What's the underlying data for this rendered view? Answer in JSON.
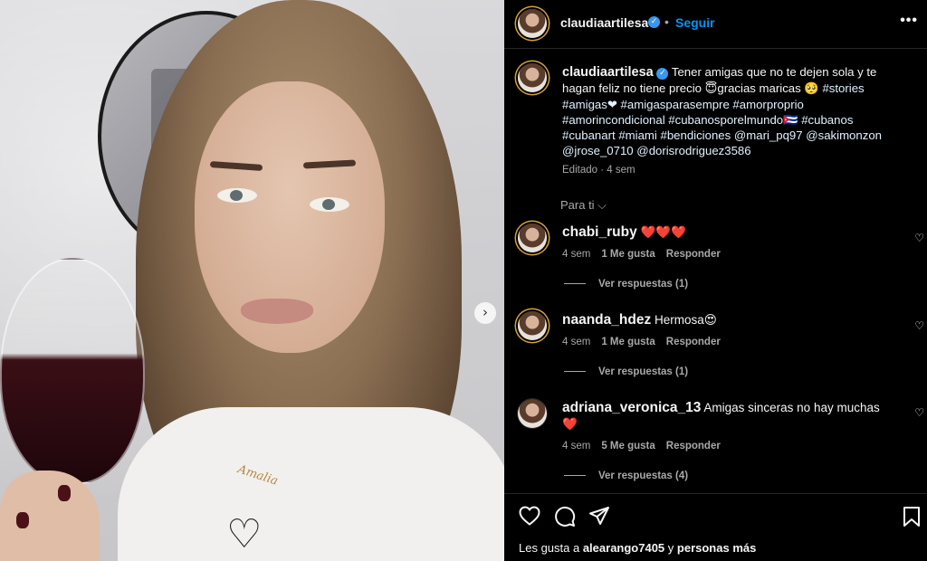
{
  "post": {
    "username": "claudiaartilesa",
    "follow_label": "Seguir",
    "more_label": "•••",
    "dot": "•"
  },
  "caption": {
    "username": "claudiaartilesa",
    "text_part1": "Tener amigas que no te dejen sola y te hagan feliz no tiene precio 😇gracias maricas 🥺 ",
    "hashtags": "#stories #amigas❤ #amigasparasempre #amorproprio #amorincondicional #cubanosporelmundo🇨🇺 #cubanos #cubanart #miami #bendiciones",
    "mentions": "@mari_pq97 @sakimonzon @jrose_0710 @dorisrodriguez3586",
    "meta": "Editado · 4 sem"
  },
  "filter": {
    "label": "Para ti ⌵"
  },
  "comments": [
    {
      "username": "chabi_ruby",
      "text": "❤️❤️❤️",
      "time": "4 sem",
      "likes": "1 Me gusta",
      "reply": "Responder",
      "view_replies": "Ver respuestas (1)"
    },
    {
      "username": "naanda_hdez",
      "text": "Hermosa😍",
      "time": "4 sem",
      "likes": "1 Me gusta",
      "reply": "Responder",
      "view_replies": "Ver respuestas (1)"
    },
    {
      "username": "adriana_veronica_13",
      "text": "Amigas sinceras no hay muchas",
      "text2": "❤️",
      "time": "4 sem",
      "likes": "5 Me gusta",
      "reply": "Responder",
      "view_replies": "Ver respuestas (4)"
    }
  ],
  "likes_line": {
    "prefix": "Les gusta a ",
    "user": "alearango7405",
    "middle": " y ",
    "suffix": "personas más"
  },
  "photo": {
    "necklace_text": "Amalia",
    "carousel_next": "›"
  },
  "icons": {
    "verified": "verified-badge-icon",
    "like": "heart-icon",
    "comment": "comment-icon",
    "share": "paper-plane-icon",
    "save": "bookmark-icon"
  },
  "colors": {
    "background": "#000000",
    "link_blue": "#0095f6",
    "verified_blue": "#3897f0",
    "heart_red": "#ed4956",
    "muted_text": "#a8a8a8"
  }
}
